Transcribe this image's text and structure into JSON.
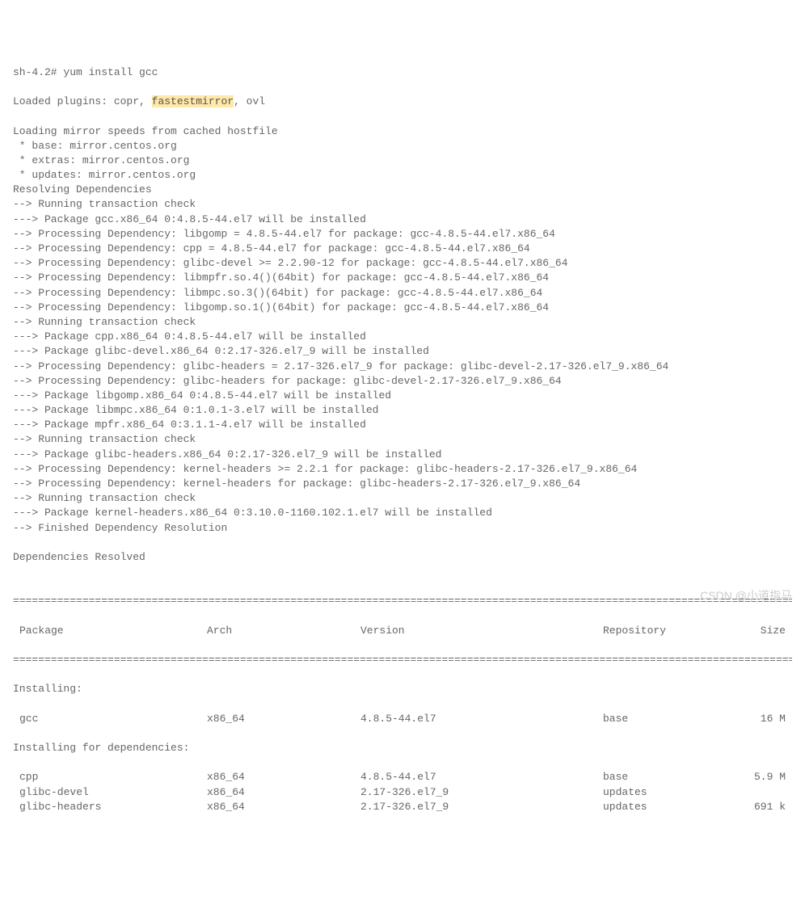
{
  "prompt": "sh-4.2# ",
  "command": "yum install gcc",
  "plugins_prefix": "Loaded plugins: copr, ",
  "plugins_highlight": "fastestmirror",
  "plugins_suffix": ", ovl",
  "lines": [
    "Loading mirror speeds from cached hostfile",
    " * base: mirror.centos.org",
    " * extras: mirror.centos.org",
    " * updates: mirror.centos.org",
    "Resolving Dependencies",
    "--> Running transaction check",
    "---> Package gcc.x86_64 0:4.8.5-44.el7 will be installed",
    "--> Processing Dependency: libgomp = 4.8.5-44.el7 for package: gcc-4.8.5-44.el7.x86_64",
    "--> Processing Dependency: cpp = 4.8.5-44.el7 for package: gcc-4.8.5-44.el7.x86_64",
    "--> Processing Dependency: glibc-devel >= 2.2.90-12 for package: gcc-4.8.5-44.el7.x86_64",
    "--> Processing Dependency: libmpfr.so.4()(64bit) for package: gcc-4.8.5-44.el7.x86_64",
    "--> Processing Dependency: libmpc.so.3()(64bit) for package: gcc-4.8.5-44.el7.x86_64",
    "--> Processing Dependency: libgomp.so.1()(64bit) for package: gcc-4.8.5-44.el7.x86_64",
    "--> Running transaction check",
    "---> Package cpp.x86_64 0:4.8.5-44.el7 will be installed",
    "---> Package glibc-devel.x86_64 0:2.17-326.el7_9 will be installed",
    "--> Processing Dependency: glibc-headers = 2.17-326.el7_9 for package: glibc-devel-2.17-326.el7_9.x86_64",
    "--> Processing Dependency: glibc-headers for package: glibc-devel-2.17-326.el7_9.x86_64",
    "---> Package libgomp.x86_64 0:4.8.5-44.el7 will be installed",
    "---> Package libmpc.x86_64 0:1.0.1-3.el7 will be installed",
    "---> Package mpfr.x86_64 0:3.1.1-4.el7 will be installed",
    "--> Running transaction check",
    "---> Package glibc-headers.x86_64 0:2.17-326.el7_9 will be installed",
    "--> Processing Dependency: kernel-headers >= 2.2.1 for package: glibc-headers-2.17-326.el7_9.x86_64",
    "--> Processing Dependency: kernel-headers for package: glibc-headers-2.17-326.el7_9.x86_64",
    "--> Running transaction check",
    "---> Package kernel-headers.x86_64 0:3.10.0-1160.102.1.el7 will be installed",
    "--> Finished Dependency Resolution",
    "",
    "Dependencies Resolved",
    ""
  ],
  "divider": "================================================================================================================================",
  "headers": {
    "package": "Package",
    "arch": "Arch",
    "version": "Version",
    "repo": "Repository",
    "size": "Size"
  },
  "sections": {
    "installing": "Installing:",
    "installing_deps": "Installing for dependencies:"
  },
  "packages_main": [
    {
      "name": "gcc",
      "arch": "x86_64",
      "version": "4.8.5-44.el7",
      "repo": "base",
      "size": "16 M"
    }
  ],
  "packages_deps": [
    {
      "name": "cpp",
      "arch": "x86_64",
      "version": "4.8.5-44.el7",
      "repo": "base",
      "size": "5.9 M"
    },
    {
      "name": "glibc-devel",
      "arch": "x86_64",
      "version": "2.17-326.el7_9",
      "repo": "updates",
      "size": ""
    },
    {
      "name": "glibc-headers",
      "arch": "x86_64",
      "version": "2.17-326.el7_9",
      "repo": "updates",
      "size": "691 k"
    }
  ],
  "watermark": "CSDN @小道指马"
}
